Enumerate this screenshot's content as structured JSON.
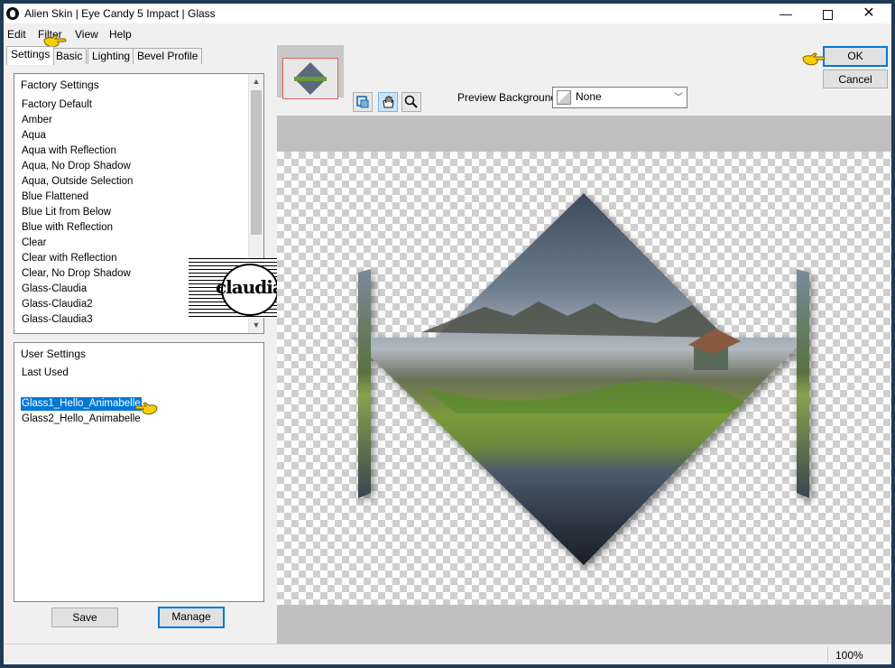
{
  "window": {
    "title": "Alien Skin | Eye Candy 5 Impact | Glass"
  },
  "window_controls": {
    "minimize": "—",
    "close": "✕"
  },
  "menu": [
    "Edit",
    "Filter",
    "View",
    "Help"
  ],
  "tabs": [
    "Settings",
    "Basic",
    "Lighting",
    "Bevel Profile"
  ],
  "factory_settings": {
    "header": "Factory Settings",
    "items": [
      "Factory Default",
      "Amber",
      "Aqua",
      "Aqua with Reflection",
      "Aqua, No Drop Shadow",
      "Aqua, Outside Selection",
      "Blue Flattened",
      "Blue Lit from Below",
      "Blue with Reflection",
      "Clear",
      "Clear with Reflection",
      "Clear, No Drop Shadow",
      "Glass-Claudia",
      "Glass-Claudia2",
      "Glass-Claudia3"
    ]
  },
  "user_settings": {
    "header": "User Settings",
    "last_used": "Last Used",
    "items": [
      "Glass1_Hello_Animabelle",
      "Glass2_Hello_Animabelle"
    ],
    "selected": "Glass1_Hello_Animabelle"
  },
  "buttons": {
    "save": "Save",
    "manage": "Manage",
    "ok": "OK",
    "cancel": "Cancel"
  },
  "preview": {
    "background_label": "Preview Background:",
    "background_value": "None"
  },
  "status": {
    "zoom": "100%"
  },
  "watermark": {
    "text": "claudia"
  },
  "colors": {
    "selection": "#0078d7",
    "default_button_border": "#0078d7",
    "checker": "#cfcfcf"
  },
  "icons": [
    "app-logo-icon",
    "navigator-icon",
    "hand-tool-icon",
    "zoom-tool-icon",
    "pointing-hand-icon"
  ]
}
